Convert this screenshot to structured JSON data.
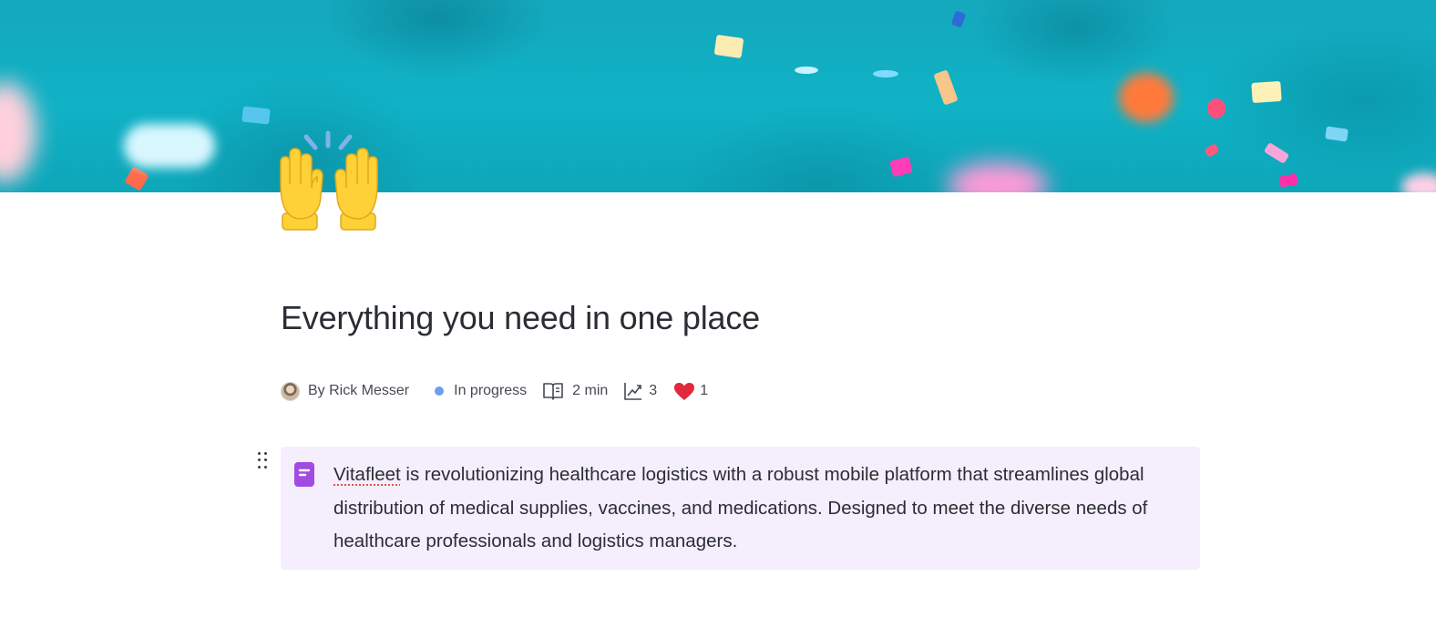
{
  "cover": {
    "colors": {
      "background": "#10b2c6"
    }
  },
  "page": {
    "icon": "raising-hands-emoji",
    "title": "Everything you need in one place"
  },
  "meta": {
    "author": "By Rick Messer",
    "status": "In progress",
    "status_color": "#6b9ff0",
    "read_time": "2 min",
    "views": "3",
    "likes": "1",
    "icons": [
      "avatar",
      "book-open-icon",
      "trending-up-icon",
      "heart-icon"
    ]
  },
  "callout": {
    "icon": "document-icon",
    "accent": "#a24be0",
    "background": "#f5eefd",
    "flagged_word": "Vitafleet",
    "text": " is revolutionizing healthcare logistics with a robust mobile platform that streamlines global distribution of medical supplies, vaccines, and medications. Designed to meet the diverse needs of healthcare professionals and logistics managers."
  }
}
